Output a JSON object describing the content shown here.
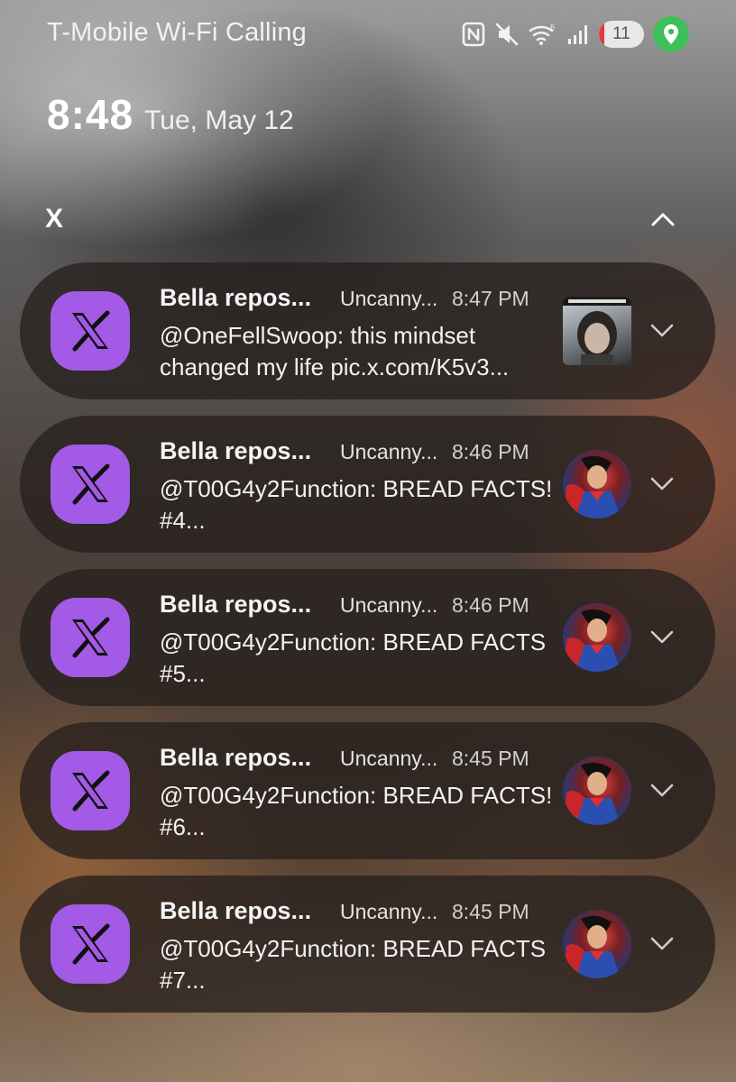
{
  "status_bar": {
    "carrier": "T-Mobile Wi-Fi Calling",
    "icons": [
      "nfc-icon",
      "mute-icon",
      "wifi-icon",
      "signal-icon"
    ],
    "battery_level": "11",
    "location_color": "#3fbf5a"
  },
  "lockscreen": {
    "time": "8:48",
    "date": "Tue, May 12"
  },
  "notification_group": {
    "app_name": "X",
    "accent_color": "#a35ae6",
    "items": [
      {
        "title": "Bella repos...",
        "subtitle": "Uncanny...",
        "time": "8:47 PM",
        "text": "@OneFellSwoop: this mindset changed my life pic.x.com/K5v3...",
        "thumbnail": "photo-thumbnail"
      },
      {
        "title": "Bella repos...",
        "subtitle": "Uncanny...",
        "time": "8:46 PM",
        "text": "@T00G4y2Function: BREAD FACTS! #4...",
        "thumbnail": "avatar-thumbnail"
      },
      {
        "title": "Bella repos...",
        "subtitle": "Uncanny...",
        "time": "8:46 PM",
        "text": "@T00G4y2Function: BREAD FACTS #5...",
        "thumbnail": "avatar-thumbnail"
      },
      {
        "title": "Bella repos...",
        "subtitle": "Uncanny...",
        "time": "8:45 PM",
        "text": "@T00G4y2Function: BREAD FACTS! #6...",
        "thumbnail": "avatar-thumbnail"
      },
      {
        "title": "Bella repos...",
        "subtitle": "Uncanny...",
        "time": "8:45 PM",
        "text": "@T00G4y2Function: BREAD FACTS #7...",
        "thumbnail": "avatar-thumbnail"
      }
    ]
  }
}
